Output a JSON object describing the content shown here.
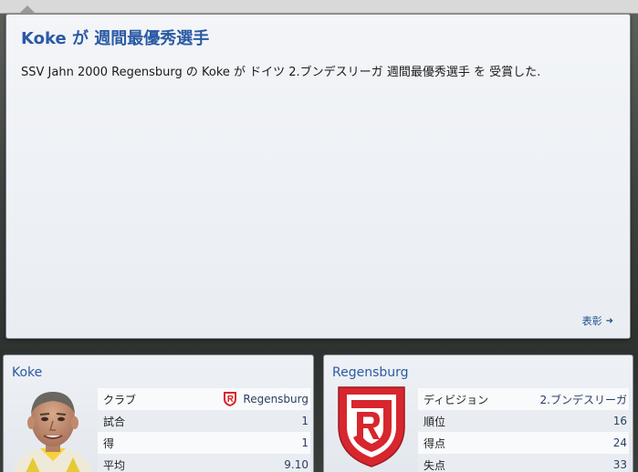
{
  "news": {
    "title": "Koke が 週間最優秀選手",
    "body": "SSV Jahn 2000 Regensburg の Koke が ドイツ 2.ブンデスリーガ 週間最優秀選手 を 受賞した.",
    "more_label": "表彰"
  },
  "player_card": {
    "title": "Koke",
    "rows": [
      {
        "label": "クラブ",
        "value": "Regensburg"
      },
      {
        "label": "試合",
        "value": "1"
      },
      {
        "label": "得",
        "value": "1"
      },
      {
        "label": "平均",
        "value": "9.10"
      }
    ]
  },
  "club_card": {
    "title": "Regensburg",
    "rows": [
      {
        "label": "ディビジョン",
        "value": "2.ブンデスリーガ"
      },
      {
        "label": "順位",
        "value": "16"
      },
      {
        "label": "得点",
        "value": "24"
      },
      {
        "label": "失点",
        "value": "33"
      }
    ]
  },
  "colors": {
    "title_blue": "#2b5aa4",
    "crest_red": "#d7262e"
  },
  "icons": {
    "more_arrow": "arrow-right-icon",
    "club_crest": "regensburg-crest-icon"
  }
}
